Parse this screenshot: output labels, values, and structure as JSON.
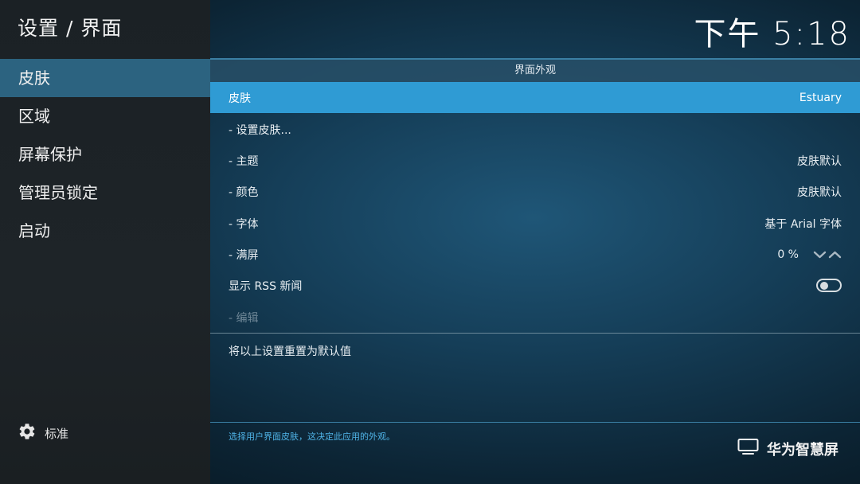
{
  "header": {
    "breadcrumb": "设置 / 界面",
    "clock": "下午 5:18"
  },
  "sidebar": {
    "items": [
      {
        "label": "皮肤",
        "active": true
      },
      {
        "label": "区域"
      },
      {
        "label": "屏幕保护"
      },
      {
        "label": "管理员锁定"
      },
      {
        "label": "启动"
      }
    ],
    "level_label": "标准",
    "level_icon": "gear-icon"
  },
  "panel": {
    "section_title": "界面外观",
    "rows": {
      "skin": {
        "label": "皮肤",
        "value": "Estuary"
      },
      "configure": {
        "label": "- 设置皮肤..."
      },
      "theme": {
        "label": "- 主题",
        "value": "皮肤默认"
      },
      "colour": {
        "label": "- 颜色",
        "value": "皮肤默认"
      },
      "font": {
        "label": "- 字体",
        "value": "基于 Arial 字体"
      },
      "zoom": {
        "label": "- 满屏",
        "value": "0 %"
      },
      "rss": {
        "label": "显示 RSS 新闻",
        "enabled": false
      },
      "edit": {
        "label": "- 编辑"
      },
      "reset": {
        "label": "将以上设置重置为默认值"
      }
    }
  },
  "footer": {
    "description": "选择用户界面皮肤，这决定此应用的外观。",
    "brand": "华为智慧屏",
    "brand_icon": "tv-icon"
  },
  "colors": {
    "selected_row": "#2f9bd4",
    "active_sidebar": "#2c6380",
    "description_text": "#4fb3e6"
  }
}
